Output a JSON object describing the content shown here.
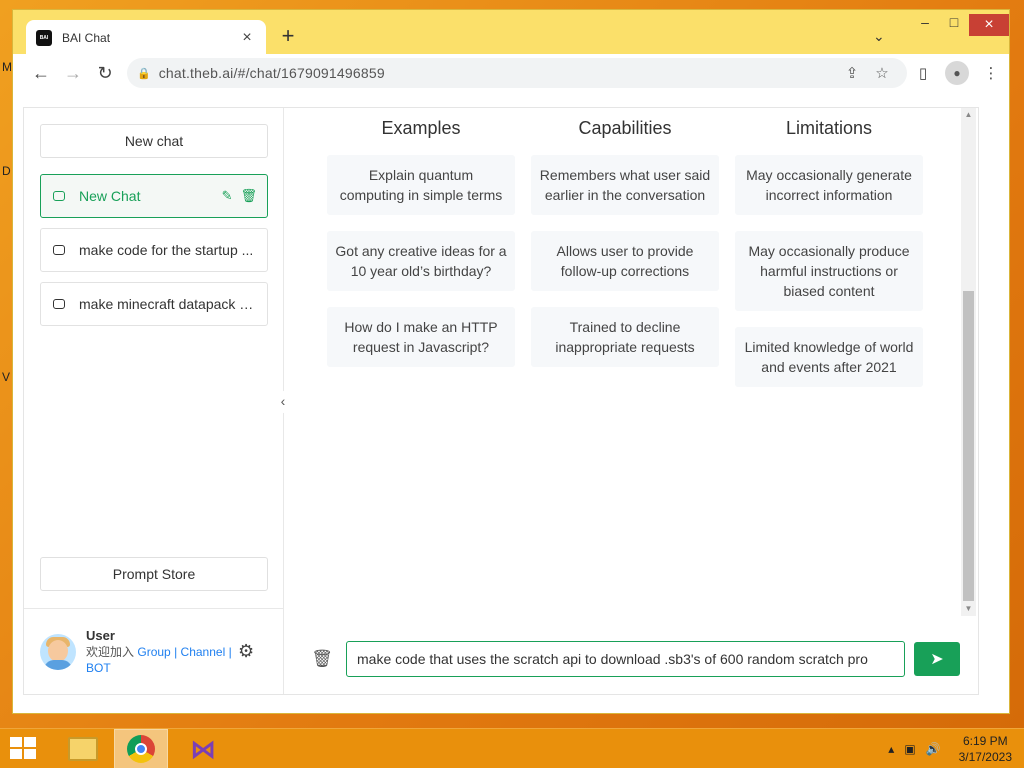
{
  "browser": {
    "tab_title": "BAI Chat",
    "favicon_text": "BAI",
    "url": "chat.theb.ai/#/chat/1679091496859"
  },
  "sidebar": {
    "new_chat_label": "New chat",
    "chats": [
      {
        "title": "New Chat",
        "active": true
      },
      {
        "title": "make code for the startup ...",
        "active": false
      },
      {
        "title": "make minecraft datapack c...",
        "active": false
      }
    ],
    "prompt_store_label": "Prompt Store",
    "user": {
      "name": "User",
      "desc_prefix": "欢迎加入",
      "link_group": "Group",
      "separator": "|",
      "link_channel": "Channel",
      "link_bot": "BOT"
    }
  },
  "main": {
    "columns": [
      {
        "header": "Examples",
        "cards": [
          "Explain quantum computing in simple terms",
          "Got any creative ideas for a 10 year old’s birthday?",
          "How do I make an HTTP request in Javascript?"
        ]
      },
      {
        "header": "Capabilities",
        "cards": [
          "Remembers what user said earlier in the conversation",
          "Allows user to provide follow-up corrections",
          "Trained to decline inappropriate requests"
        ]
      },
      {
        "header": "Limitations",
        "cards": [
          "May occasionally generate incorrect information",
          "May occasionally produce harmful instructions or biased content",
          "Limited knowledge of world and events after 2021"
        ]
      }
    ],
    "composer_value": "make code that uses the scratch api to download .sb3's of 600 random scratch pro"
  },
  "taskbar": {
    "time": "6:19 PM",
    "date": "3/17/2023"
  },
  "colors": {
    "accent": "#18a058",
    "link": "#2080f0",
    "window_frame": "#fbe06a",
    "taskbar": "#e9900c"
  }
}
